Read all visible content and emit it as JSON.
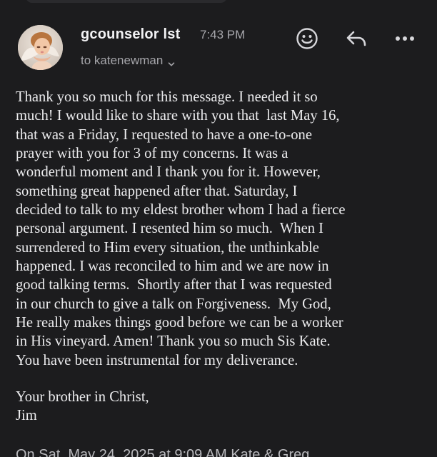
{
  "email": {
    "sender_name": "gcounselor lst",
    "time": "7:43 PM",
    "recipient_line": "to katenewman",
    "avatar_icon": "angel-avatar-icon",
    "actions": {
      "emoji": "smiley-face-icon",
      "reply": "reply-arrow-icon",
      "more": "more-dots-icon"
    },
    "body_lines": [
      "Thank you so much for this message. I needed it so",
      "much! I would like to share with you that  last May 16,",
      "that was a Friday, I requested to have a one-to-one",
      "prayer with you for 3 of my concerns. It was a",
      "wonderful moment and I thank you for it. However,",
      "something great happened after that. Saturday, I",
      "decided to talk to my eldest brother whom I had a fierce",
      "personal argument. I resented him so much.  When I",
      "surrendered to Him every situation, the unthinkable",
      "happened. I was reconciled to him and we are now in",
      "good talking terms.  Shortly after that I was requested",
      "in our church to give a talk on Forgiveness.  My God,",
      "He really makes things good before we can be a worker",
      "in His vineyard. Amen! Thank you so much Sis Kate.",
      "You have been instrumental for my deliverance."
    ],
    "signoff_lines": [
      "Your brother in Christ,",
      "Jim"
    ],
    "quote_header": "On Sat, May 24, 2025 at 9:09 AM Kate & Greg"
  },
  "colors": {
    "background": "#1c1c1e",
    "primary_text": "#ececee",
    "secondary_text": "#a6a6ab"
  }
}
